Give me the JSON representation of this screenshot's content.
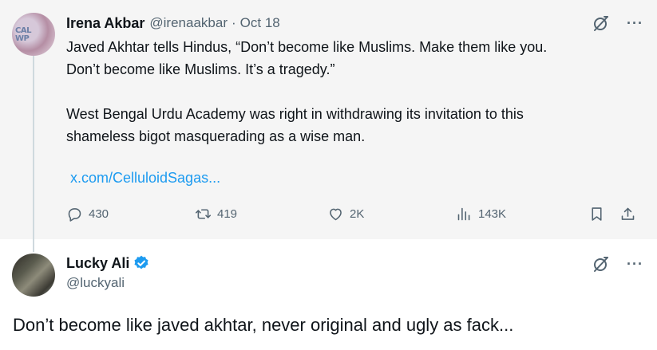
{
  "quoted_tweet": {
    "author_name": "Irena Akbar",
    "handle": "@irenaakbar",
    "separator": "·",
    "date": "Oct 18",
    "avatar_text": "CAL\nWP",
    "paragraph_1_line_1": "Javed Akhtar tells Hindus, “Don’t become like Muslims. Make them like you.",
    "paragraph_1_line_2": "Don’t become like Muslims. It’s a tragedy.”",
    "paragraph_2_line_1": "West Bengal Urdu Academy was right in withdrawing its invitation to this",
    "paragraph_2_line_2": "shameless bigot masquerading as a wise man.",
    "link": "x.com/CelluloidSagas...",
    "stats": {
      "replies": "430",
      "reposts": "419",
      "likes": "2K",
      "views": "143K"
    },
    "more_label": "···"
  },
  "reply_tweet": {
    "author_name": "Lucky Ali",
    "handle": "@luckyali",
    "verified": true,
    "text": "Don’t become like javed akhtar, never original  and ugly as fack...",
    "more_label": "···"
  },
  "colors": {
    "accent_link": "#1d9bf0",
    "verified_badge": "#1d9bf0",
    "secondary_text": "#536471",
    "quoted_background": "#f5f5f5"
  },
  "icons": [
    "grok-icon",
    "more-icon",
    "reply-icon",
    "repost-icon",
    "like-icon",
    "views-icon",
    "bookmark-icon",
    "share-icon",
    "verified-icon"
  ]
}
